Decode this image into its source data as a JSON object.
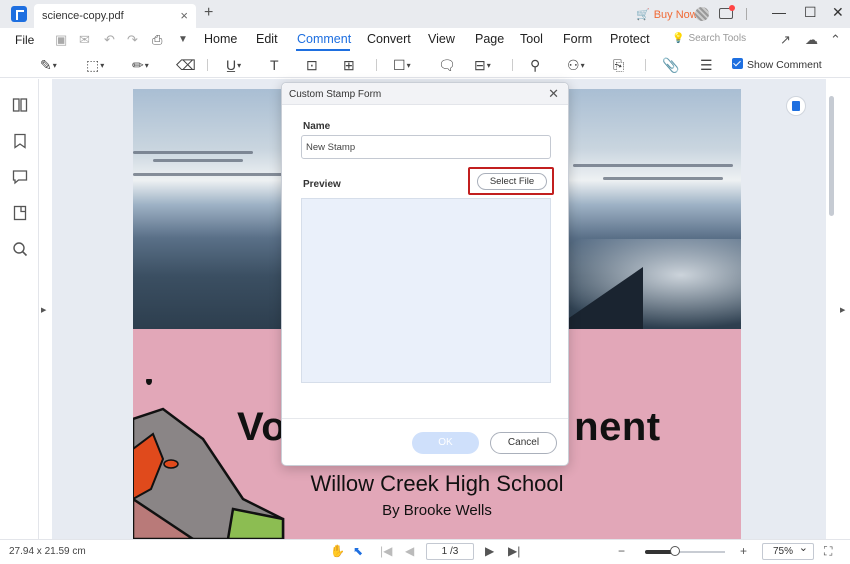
{
  "titlebar": {
    "tab_title": "science-copy.pdf",
    "buy_now": "Buy Now"
  },
  "menu": {
    "file": "File",
    "items": [
      "Home",
      "Edit",
      "Comment",
      "Convert",
      "View",
      "Page",
      "Tool",
      "Form",
      "Protect"
    ],
    "active": "Comment",
    "search_placeholder": "Search Tools"
  },
  "ribbon": {
    "show_comment": "Show Comment",
    "show_comment_checked": true
  },
  "document": {
    "title_left": "Vo",
    "title_right": "nent",
    "school": "Willow Creek High School",
    "author": "By Brooke Wells"
  },
  "dialog": {
    "title": "Custom Stamp Form",
    "name_label": "Name",
    "name_value": "New Stamp",
    "preview_label": "Preview",
    "select_file": "Select File",
    "ok": "OK",
    "cancel": "Cancel"
  },
  "status": {
    "dimensions": "27.94 x 21.59 cm",
    "page_indicator": "1 /3",
    "zoom": "75%",
    "zoom_level_fraction": 0.36
  },
  "colors": {
    "accent": "#1e6fe0",
    "highlight": "#c21f1f",
    "buy_now": "#f06a35"
  }
}
